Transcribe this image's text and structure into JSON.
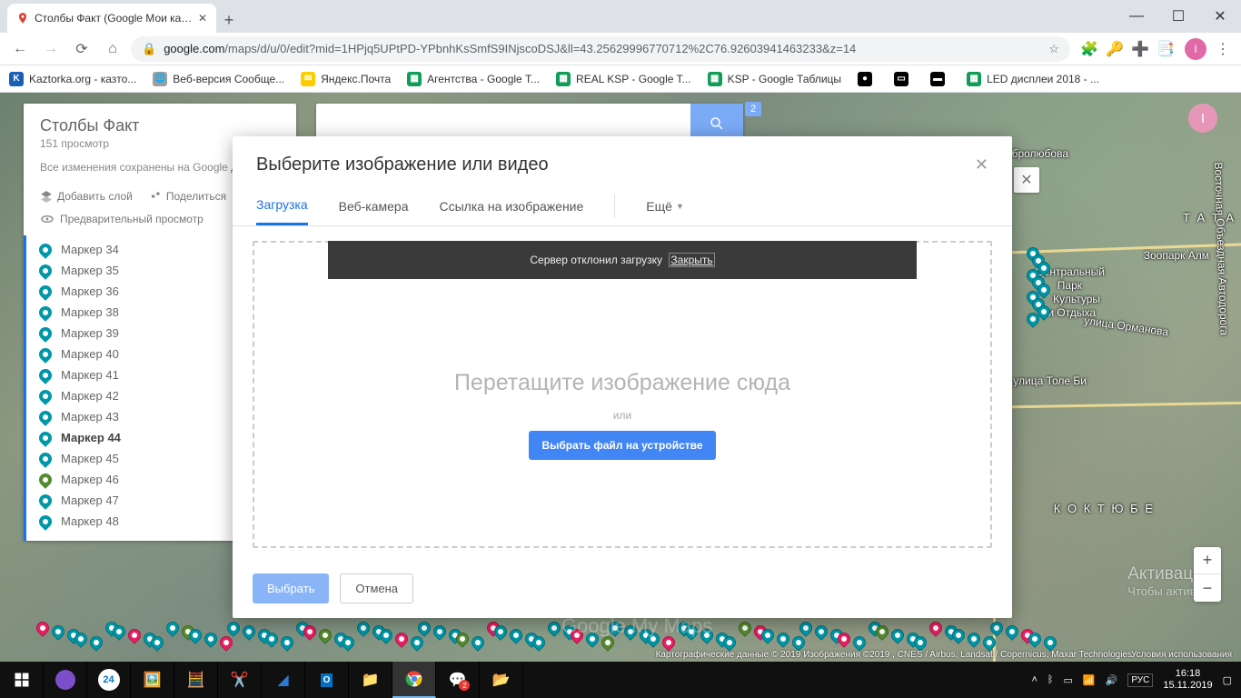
{
  "browser": {
    "tab_title": "Столбы Факт (Google Мои карты)",
    "url_host": "google.com",
    "url_path": "/maps/d/u/0/edit?mid=1HPjq5UPtPD-YPbnhKsSmfS9INjscoDSJ&ll=43.25629996770712%2C76.92603941463233&z=14",
    "bookmarks": [
      {
        "label": "Kaztorka.org - казто...",
        "color": "#1a5fb4",
        "glyph": "K"
      },
      {
        "label": "Веб-версия Сообще...",
        "color": "#9e9e9e",
        "glyph": "🌐"
      },
      {
        "label": "Яндекс.Почта",
        "color": "#ffcc00",
        "glyph": "✉"
      },
      {
        "label": "Агентства - Google Т...",
        "color": "#0f9d58",
        "glyph": "▦"
      },
      {
        "label": "REAL KSP - Google T...",
        "color": "#0f9d58",
        "glyph": "▦"
      },
      {
        "label": "KSP - Google Таблицы",
        "color": "#0f9d58",
        "glyph": "▦"
      },
      {
        "label": "",
        "color": "#000",
        "glyph": "●"
      },
      {
        "label": "",
        "color": "#000",
        "glyph": "▭"
      },
      {
        "label": "",
        "color": "#000",
        "glyph": "▬"
      },
      {
        "label": "LED дисплеи 2018 - ...",
        "color": "#0f9d58",
        "glyph": "▦"
      }
    ],
    "avatar_letter": "I"
  },
  "panel": {
    "title": "Столбы Факт",
    "views": "151 просмотр",
    "saved": "Все изменения сохранены на Google Диске",
    "add_layer": "Добавить слой",
    "share": "Поделиться",
    "preview": "Предварительный просмотр",
    "markers": [
      {
        "label": "Маркер 34",
        "color": "teal"
      },
      {
        "label": "Маркер 35",
        "color": "teal"
      },
      {
        "label": "Маркер 36",
        "color": "teal"
      },
      {
        "label": "Маркер 38",
        "color": "teal"
      },
      {
        "label": "Маркер 39",
        "color": "teal"
      },
      {
        "label": "Маркер 40",
        "color": "teal"
      },
      {
        "label": "Маркер 41",
        "color": "teal"
      },
      {
        "label": "Маркер 42",
        "color": "teal"
      },
      {
        "label": "Маркер 43",
        "color": "teal"
      },
      {
        "label": "Маркер 44",
        "color": "teal",
        "selected": true
      },
      {
        "label": "Маркер 45",
        "color": "teal"
      },
      {
        "label": "Маркер 46",
        "color": "green"
      },
      {
        "label": "Маркер 47",
        "color": "teal"
      },
      {
        "label": "Маркер 48",
        "color": "teal"
      }
    ]
  },
  "search": {
    "badge": "2"
  },
  "modal": {
    "title": "Выберите изображение или видео",
    "tabs": {
      "upload": "Загрузка",
      "webcam": "Веб-камера",
      "link": "Ссылка на изображение",
      "more": "Ещё"
    },
    "error": "Сервер отклонил загрузку",
    "error_close": "Закрыть",
    "drop_text": "Перетащите изображение сюда",
    "or": "или",
    "choose": "Выбрать файл на устройстве",
    "select": "Выбрать",
    "cancel": "Отмена"
  },
  "map": {
    "watermark": "Google My Maps",
    "attribution": "Картографические данные © 2019 Изображения ©2019 , CNES / Airbus, Landsat / Copernicus, Maxar Technologies",
    "terms": "Условия использования",
    "labels": {
      "dobrolubova": "улица Добролюбова",
      "park1": "Центральный",
      "park2": "Парк",
      "park3": "Культуры",
      "park4": "и Отдыха",
      "zoo": "Зоопарк Алм",
      "ormanova": "улица Орманова",
      "tolebi": "улица Толе Би",
      "tata": "Т А Т А",
      "koktobe": "К О К Т Ю Б Е",
      "avtodoroga": "Восточная Объездная Автодорога"
    }
  },
  "activation": {
    "h": "Активация",
    "sub": "Чтобы активир"
  },
  "taskbar": {
    "lang": "РУС",
    "time": "16:18",
    "date": "15.11.2019"
  }
}
